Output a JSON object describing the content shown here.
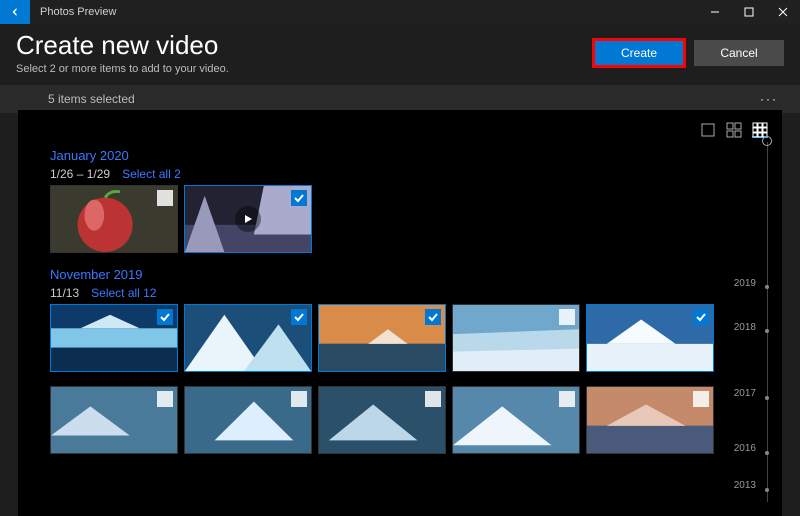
{
  "app": {
    "title": "Photos Preview"
  },
  "header": {
    "title": "Create new video",
    "subtitle": "Select 2 or more items to add to your video.",
    "create_label": "Create",
    "cancel_label": "Cancel"
  },
  "toolbar": {
    "selected_text": "5 items selected"
  },
  "views": {
    "single": "single-view",
    "grid2": "grid2-view",
    "grid3": "grid3-view",
    "active": "grid3"
  },
  "groups": [
    {
      "month": "January 2020",
      "range": "1/26 – 1/29",
      "select_all": "Select all 2",
      "items": [
        {
          "kind": "photo",
          "subject": "apple-fruit",
          "selected": false
        },
        {
          "kind": "video",
          "subject": "waterfall-ice",
          "selected": true
        }
      ]
    },
    {
      "month": "November 2019",
      "range": "11/13",
      "select_all": "Select all 12",
      "items": [
        {
          "kind": "photo",
          "subject": "glacier-blue",
          "selected": true
        },
        {
          "kind": "photo",
          "subject": "iceberg-closeup",
          "selected": true
        },
        {
          "kind": "photo",
          "subject": "iceberg-sunset",
          "selected": true
        },
        {
          "kind": "photo",
          "subject": "glacier-wall",
          "selected": false
        },
        {
          "kind": "photo",
          "subject": "snow-mountain",
          "selected": true
        }
      ],
      "items_row2": [
        {
          "kind": "photo",
          "subject": "iceberg-1",
          "selected": false
        },
        {
          "kind": "photo",
          "subject": "iceberg-2",
          "selected": false
        },
        {
          "kind": "photo",
          "subject": "iceberg-3",
          "selected": false
        },
        {
          "kind": "photo",
          "subject": "iceberg-4",
          "selected": false
        },
        {
          "kind": "photo",
          "subject": "sunset-peaks",
          "selected": false
        }
      ]
    }
  ],
  "timeline": {
    "years": [
      "2019",
      "2018",
      "2017",
      "2016",
      "2013"
    ]
  }
}
